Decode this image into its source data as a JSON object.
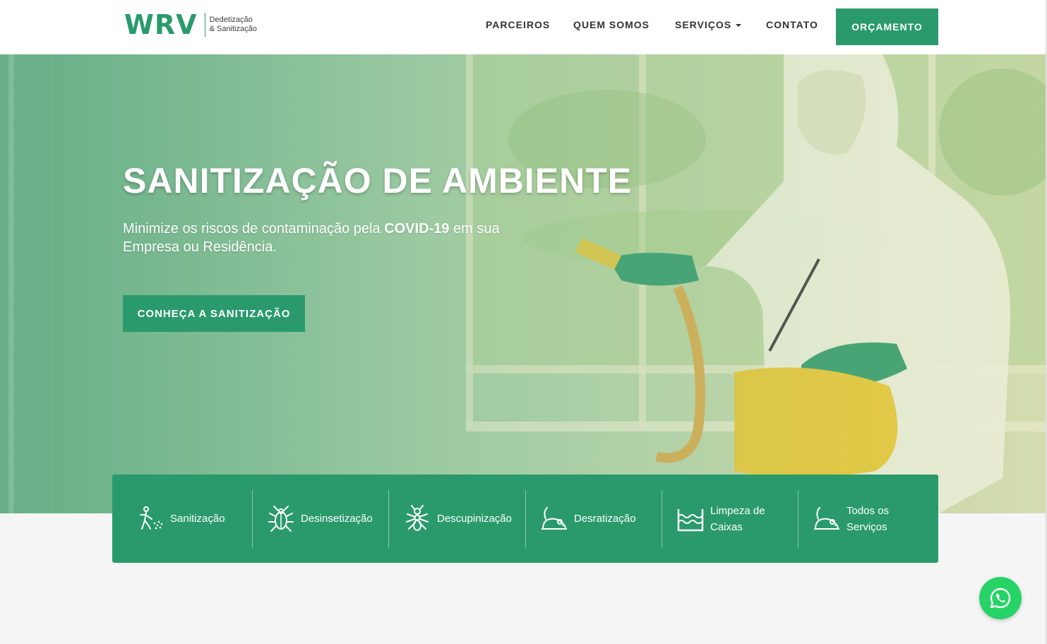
{
  "header": {
    "logo_mark": "WRV",
    "logo_tag_line1": "Dedetização",
    "logo_tag_line2": "& Sanitização",
    "nav": {
      "parceiros": "PARCEIROS",
      "quem_somos": "QUEM SOMOS",
      "servicos": "SERVIÇOS",
      "contato": "CONTATO"
    },
    "cta_label": "ORÇAMENTO"
  },
  "hero": {
    "title": "SANITIZAÇÃO DE AMBIENTE",
    "subtitle_part1": "Minimize os riscos de contaminação pela ",
    "subtitle_bold": "COVID-19",
    "subtitle_part2": " em sua Empresa ou Residência.",
    "button_label": "CONHEÇA A SANITIZAÇÃO"
  },
  "services": [
    {
      "label": "Sanitização",
      "icon": "sanitizer-person-icon"
    },
    {
      "label": "Desinsetização",
      "icon": "cockroach-icon"
    },
    {
      "label": "Descupinização",
      "icon": "termite-icon"
    },
    {
      "label": "Desratização",
      "icon": "rat-icon"
    },
    {
      "label": "Limpeza de Caixas",
      "icon": "water-tank-icon"
    },
    {
      "label": "Todos os Serviços",
      "icon": "rat-icon"
    }
  ],
  "colors": {
    "brand_green": "#2a9a6c",
    "whatsapp_green": "#25d366"
  }
}
